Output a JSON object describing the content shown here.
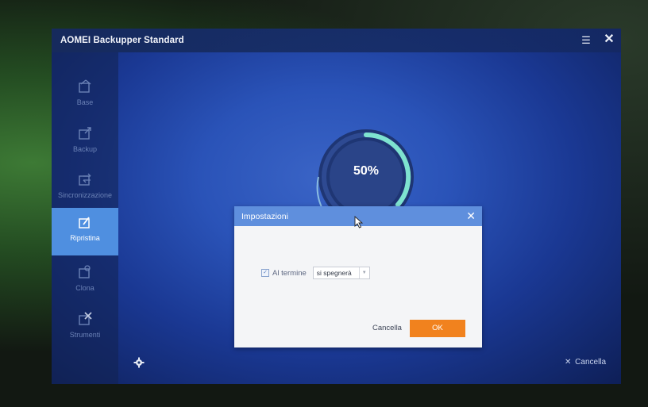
{
  "window": {
    "title": "AOMEI Backupper Standard"
  },
  "sidebar": {
    "items": [
      {
        "label": "Base",
        "icon": "home-icon",
        "active": false
      },
      {
        "label": "Backup",
        "icon": "backup-icon",
        "active": false
      },
      {
        "label": "Sincronizzazione",
        "icon": "sync-icon",
        "active": false
      },
      {
        "label": "Ripristina",
        "icon": "restore-icon",
        "active": true
      },
      {
        "label": "Clona",
        "icon": "clone-icon",
        "active": false
      },
      {
        "label": "Strumenti",
        "icon": "tools-icon",
        "active": false
      }
    ]
  },
  "progress": {
    "percent_text": "50%",
    "value": 0.5
  },
  "footer": {
    "cancel_label": "Cancella"
  },
  "dialog": {
    "title": "Impostazioni",
    "checkbox_label": "Al termine",
    "checkbox_checked": true,
    "select_value": "si spegnerà",
    "cancel_label": "Cancella",
    "ok_label": "OK"
  },
  "colors": {
    "accent_blue": "#5f8fdd",
    "ok_orange": "#f1821e",
    "progress_teal": "#7ee3d0"
  }
}
